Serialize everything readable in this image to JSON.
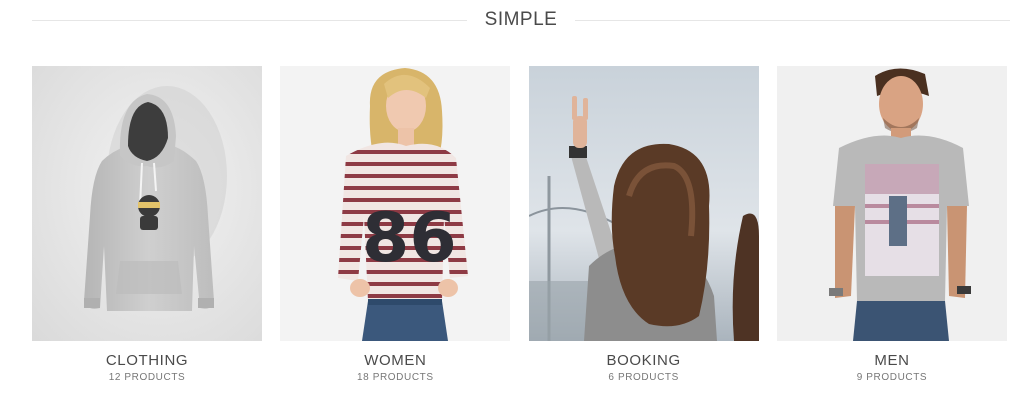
{
  "section": {
    "title": "SIMPLE"
  },
  "categories": [
    {
      "name": "CLOTHING",
      "count": "12 PRODUCTS",
      "image": "grey-hoodie-photo"
    },
    {
      "name": "WOMEN",
      "count": "18 PRODUCTS",
      "image": "striped-sweater-woman-photo"
    },
    {
      "name": "BOOKING",
      "count": "6 PRODUCTS",
      "image": "woman-peace-sign-photo"
    },
    {
      "name": "MEN",
      "count": "9 PRODUCTS",
      "image": "man-grey-tshirt-photo"
    }
  ],
  "colors": {
    "text": "#4a4a4a",
    "subtext": "#777777",
    "rule": "#e6e6e6"
  }
}
